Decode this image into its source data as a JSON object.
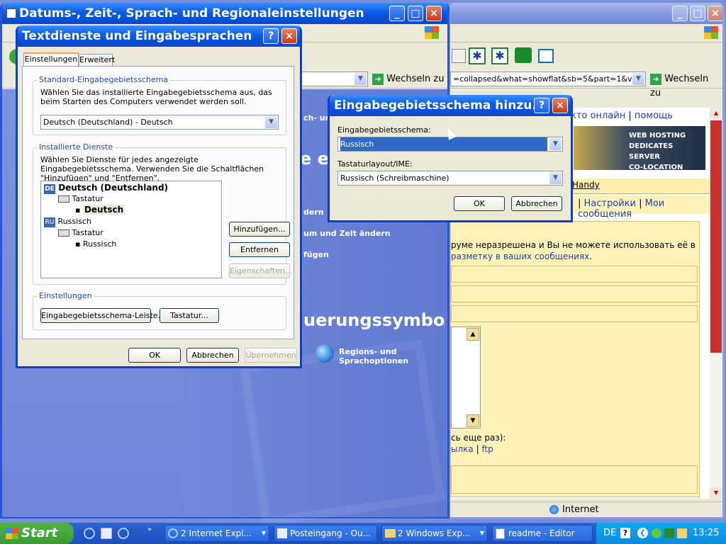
{
  "bg_window": {
    "title": "Datums-, Zeit-, Sprach- und Regionaleinstellungen",
    "partial_tasks": [
      "ch- und",
      "dern",
      "um und Zeit ändern",
      "fügen"
    ],
    "partial_heading_1": "e ei",
    "partial_heading_2": "uerungssymbo",
    "regional_link": "Regions- und Sprachoptionen"
  },
  "browser": {
    "address": "=collapsed&what=showflat&sb=5&part=1&vc",
    "go_label": "Wechseln zu",
    "go_label_left": "Wechseln zu",
    "header_links": [
      "кто онлайн",
      "помощь"
    ],
    "banner_lines": [
      "WEB HOSTING",
      "DEDICATES SERVER",
      "CO-LOCATION"
    ],
    "handy": "Handy",
    "nav_links": [
      "Настройки",
      "Мои сообщения"
    ],
    "notice_line1": "руме неразрешена и Вы не можете использовать её в",
    "notice_line2": "разметку в ваших сообщениях",
    "bottom_line1": "сь еще раз):",
    "bottom_link1": "ылка",
    "bottom_link2": "ftp",
    "status": "Internet"
  },
  "text_services": {
    "title": "Textdienste und Eingabesprachen",
    "tabs": [
      "Einstellungen",
      "Erweitert"
    ],
    "default_group": "Standard-Eingabegebietsschema",
    "default_desc": "Wählen Sie das installierte Eingabegebietsschema aus, das beim Starten des Computers verwendet werden soll.",
    "default_value": "Deutsch (Deutschland) - Deutsch",
    "installed_group": "Installierte Dienste",
    "installed_desc": "Wählen Sie Dienste für jedes angezeigte Eingabegebietsschema. Verwenden Sie die Schaltflächen \"Hinzufügen\" und \"Entfernen\".",
    "tree": {
      "lang1_code": "DE",
      "lang1": "Deutsch (Deutschland)",
      "keyboard1": "Tastatur",
      "layout1": "Deutsch",
      "lang2_code": "RU",
      "lang2": "Russisch",
      "keyboard2": "Tastatur",
      "layout2": "Russisch"
    },
    "add": "Hinzufügen...",
    "remove": "Entfernen",
    "properties": "Eigenschaften...",
    "settings_group": "Einstellungen",
    "langbar_btn": "Eingabegebietsschema-Leiste...",
    "keys_btn": "Tastatur...",
    "ok": "OK",
    "cancel": "Abbrechen",
    "apply": "Übernehmen"
  },
  "add_dialog": {
    "title": "Eingabegebietsschema hinzu...",
    "locale_label": "Eingabegebietsschema:",
    "locale_value": "Russisch",
    "layout_label": "Tastaturlayout/IME:",
    "layout_value": "Russisch (Schreibmaschine)",
    "ok": "OK",
    "cancel": "Abbrechen"
  },
  "taskbar": {
    "start": "Start",
    "tasks": [
      "2 Internet Expl...",
      "Posteingang - Ou...",
      "2 Windows Exp...",
      "readme - Editor"
    ],
    "lang": "DE",
    "clock": "13:25"
  },
  "colors": {
    "xp_blue": "#0a3fd1",
    "cp_blue": "#6f86d9",
    "forum_bg": "#fff2b8"
  }
}
